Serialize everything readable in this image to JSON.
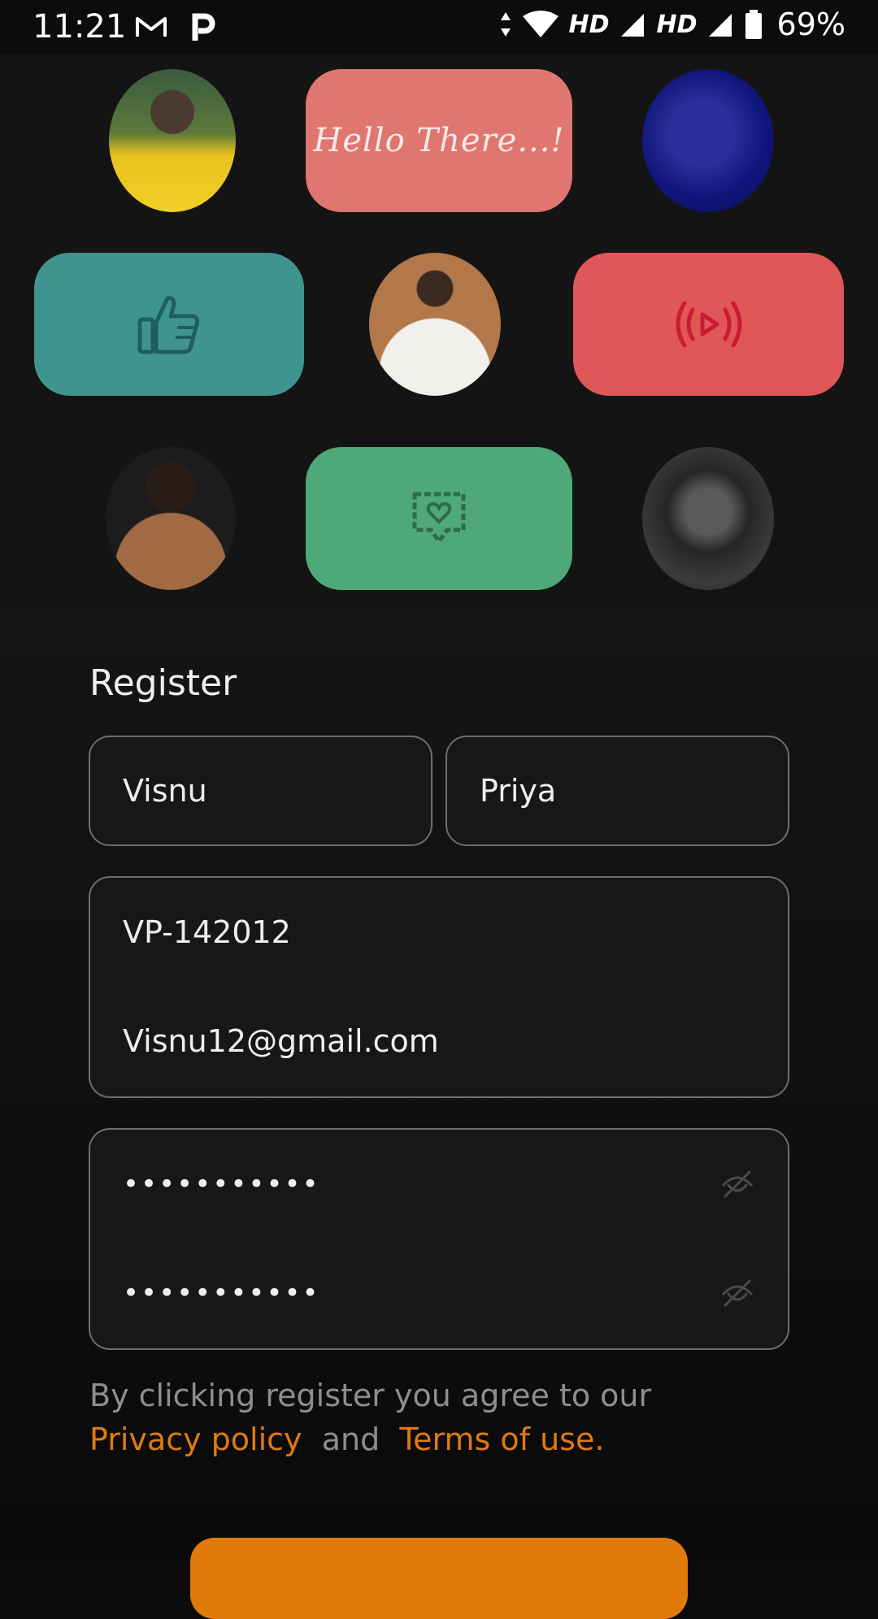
{
  "status_bar": {
    "time": "11:21",
    "left_icons": [
      "gmail-icon",
      "paytm-icon"
    ],
    "network_label_1": "HD",
    "network_label_2": "HD",
    "battery_percent": "69%"
  },
  "tiles": {
    "hello_text": "Hello There...!",
    "colors": {
      "salmon": "#e07670",
      "teal": "#3f958e",
      "red": "#df5759",
      "green": "#4fa878",
      "icon_teal_dark": "#1f5f5a",
      "icon_red_dark": "#c91c34",
      "icon_green_dark": "#2e6b4c"
    },
    "icons": [
      "thumbs-up-icon",
      "broadcast-icon",
      "heart-message-icon"
    ]
  },
  "form": {
    "title": "Register",
    "first_name": "Visnu",
    "last_name": "Priya",
    "user_id": "VP-142012",
    "email": "Visnu12@gmail.com",
    "password_masked": "•••••••••••",
    "confirm_password_masked": "•••••••••••"
  },
  "consent": {
    "text": "By clicking register you agree to our",
    "privacy_link": "Privacy policy",
    "and_text": "and",
    "terms_link": "Terms of use."
  },
  "accent_color": "#e07a0a"
}
